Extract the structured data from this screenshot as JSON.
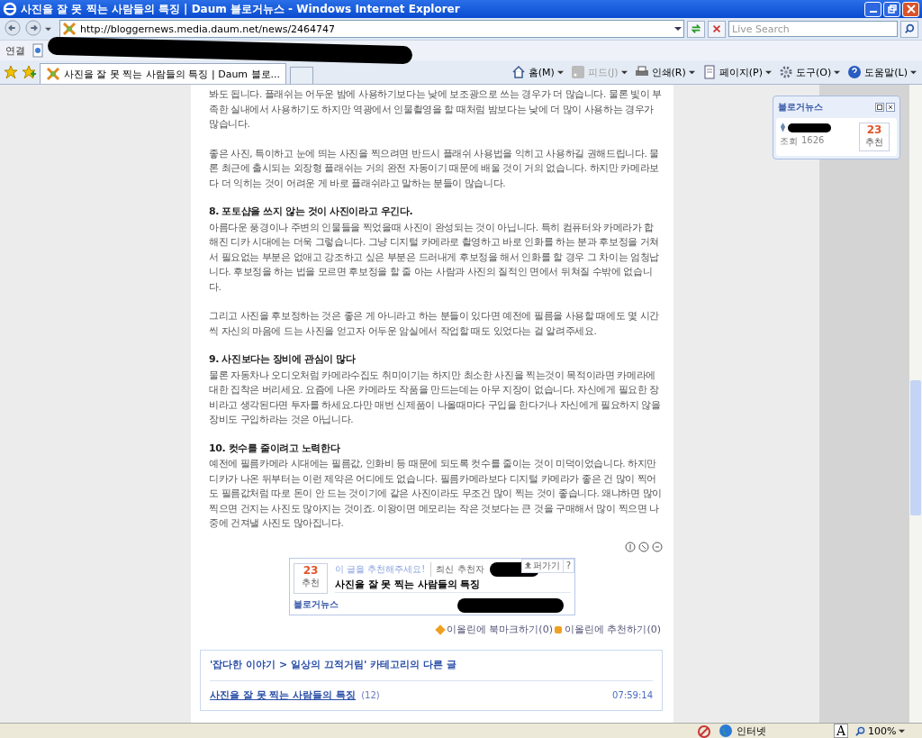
{
  "window": {
    "title": "사진을 잘 못 찍는 사람들의 특징 | Daum 블로거뉴스 - Windows Internet Explorer"
  },
  "address_bar": {
    "url": "http://bloggernews.media.daum.net/news/2464747"
  },
  "search": {
    "placeholder": "Live Search"
  },
  "links_bar": {
    "label": "연결"
  },
  "tabs": [
    {
      "label": "사진을 잘 못 찍는 사람들의 특징 | Daum 블로...",
      "selected": true
    }
  ],
  "command_bar": [
    {
      "label": "홈(M)",
      "kind": "home",
      "disabled": false
    },
    {
      "label": "피드(J)",
      "kind": "feed",
      "disabled": true
    },
    {
      "label": "인쇄(R)",
      "kind": "print",
      "disabled": false
    },
    {
      "label": "페이지(P)",
      "kind": "page",
      "disabled": false
    },
    {
      "label": "도구(O)",
      "kind": "tools",
      "disabled": false
    },
    {
      "label": "도움말(L)",
      "kind": "help",
      "disabled": false
    }
  ],
  "article": [
    {
      "kind": "paragraph",
      "text": "봐도 됩니다. 플래쉬는 어두운 밤에 사용하기보다는 낮에 보조광으로 쓰는 경우가 더 많습니다. 물론 빛이 부족한 실내에서 사용하기도 하지만 역광에서 인물촬영을 할 때처럼 밤보다는 낮에 더 많이 사용하는 경우가 많습니다."
    },
    {
      "kind": "paragraph",
      "text": "좋은 사진, 특이하고 눈에 띄는 사진을 찍으려면 반드시 플래쉬 사용법을 익히고 사용하길 권해드립니다. 물론 최근에 출시되는 외장형 플래쉬는 거의 완전 자동이기 때문에 배울 것이 거의 없습니다. 하지만 카메라보다 더 익히는 것이 어려운 게 바로 플래쉬라고 말하는 분들이 많습니다."
    },
    {
      "kind": "heading",
      "text": "8. 포토샵을 쓰지 않는 것이 사진이라고 우긴다."
    },
    {
      "kind": "paragraph",
      "text": "아름다운 풍경이나 주변의 인물들을  찍었을때 사진이 완성되는 것이 아닙니다. 특히 컴퓨터와 카메라가 합해진 디카 시대에는 더욱 그렇습니다. 그냥 디지털 카메라로 촬영하고 바로 인화를 하는 분과 후보정을 거쳐서 필요없는 부분은 없애고 강조하고 싶은 부분은 드러내게 후보정을 해서 인화를 할 경우 그 차이는 엄청납니다. 후보정을 하는 법을 모르면 후보정을 할 줄 아는 사람과 사진의 질적인 면에서 뒤쳐질 수밖에 없습니다."
    },
    {
      "kind": "paragraph",
      "text": "그리고 사진을 후보정하는 것은 좋은 게 아니라고 하는 분들이 있다면 예전에 필름을 사용할 때에도 몇 시간씩 자신의 마음에 드는 사진을 얻고자 어두운 암실에서 작업할 때도 있었다는 걸 알려주세요."
    },
    {
      "kind": "heading",
      "text": "9. 사진보다는 장비에 관심이 많다"
    },
    {
      "kind": "paragraph",
      "text": "물론 자동차나 오디오처럼 카메라수집도 취미이기는 하지만 최소한 사진을 찍는것이 목적이라면 카메라에 대한 집착은 버리세요. 요즘에 나온 카메라도 작품을 만드는데는 아무 지장이 없습니다. 자신에게 필요한 장비라고 생각된다면 투자를 하세요.다만 매번 신제품이 나올때마다 구입을 한다거나 자신에게 필요하지 않을 장비도 구입하라는 것은 아닙니다."
    },
    {
      "kind": "heading",
      "text": "10. 컷수를 줄이려고 노력한다"
    },
    {
      "kind": "paragraph",
      "text": "예전에 필름카메라 시대에는 필름값, 인화비 등 때문에 되도록 컷수를 줄이는 것이 미덕이었습니다. 하지만 디카가 나온 뒤부터는 이런 제약은 어디에도 없습니다. 필름카메라보다 디지털 카메라가 좋은 건 많이 찍어도 필름값처럼 따로 돈이 안 드는 것이기에 같은 사진이라도 무조건 많이 찍는 것이 좋습니다. 왜냐하면 많이 찍으면 건지는 사진도 많아지는 것이죠. 이왕이면 메모리는 작은 것보다는 큰 것을 구매해서 많이 찍으면 나중에 건져낼 사진도 많아집니다."
    }
  ],
  "recommend_box": {
    "count": "23",
    "count_label": "추천",
    "prompt": "이 글을 추천해주세요!",
    "recent_label": "최신 추천자",
    "title": "사진을 잘 못 찍는 사람들의 특징",
    "brand": "블로거뉴스",
    "share": "퍼가기",
    "help": "?"
  },
  "eolin_links": [
    "이올린에 북마크하기(0)",
    "이올린에 추천하기(0)"
  ],
  "category_box": {
    "heading": "'잡다한 이야기 > 일상의 끄적거림' 카테고리의 다른 글",
    "posts": [
      {
        "title": "사진을 잘 못 찍는 사람들의 특징",
        "count": "(12)",
        "time": "07:59:14"
      }
    ]
  },
  "widget": {
    "title": "블로거뉴스",
    "views_label": "조회",
    "views": "1626",
    "count": "23",
    "count_label": "추천"
  },
  "status_bar": {
    "zone": "인터넷",
    "text_size": "A",
    "zoom": "100%"
  }
}
